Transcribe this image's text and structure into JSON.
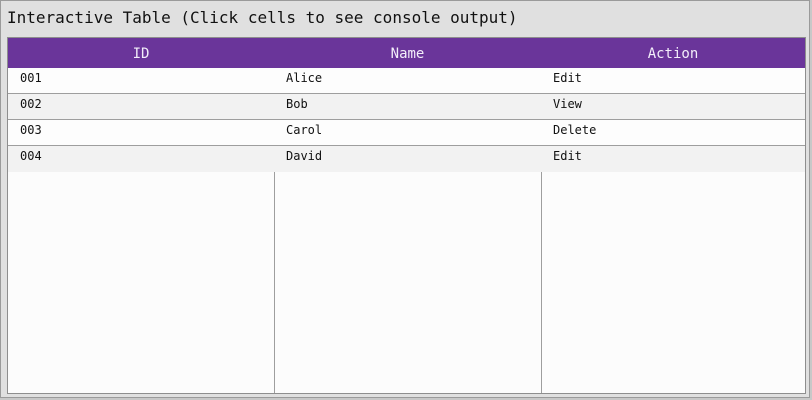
{
  "window": {
    "title": "Interactive Table (Click cells to see console output)"
  },
  "table": {
    "columns": [
      "ID",
      "Name",
      "Action"
    ],
    "rows": [
      [
        "001",
        "Alice",
        "Edit"
      ],
      [
        "002",
        "Bob",
        "View"
      ],
      [
        "003",
        "Carol",
        "Delete"
      ],
      [
        "004",
        "David",
        "Edit"
      ]
    ]
  },
  "colors": {
    "header_bg": "#6a359a",
    "header_text": "#f3eefa",
    "row_alt": "#f2f2f2",
    "row_white": "#fdfdfd"
  }
}
